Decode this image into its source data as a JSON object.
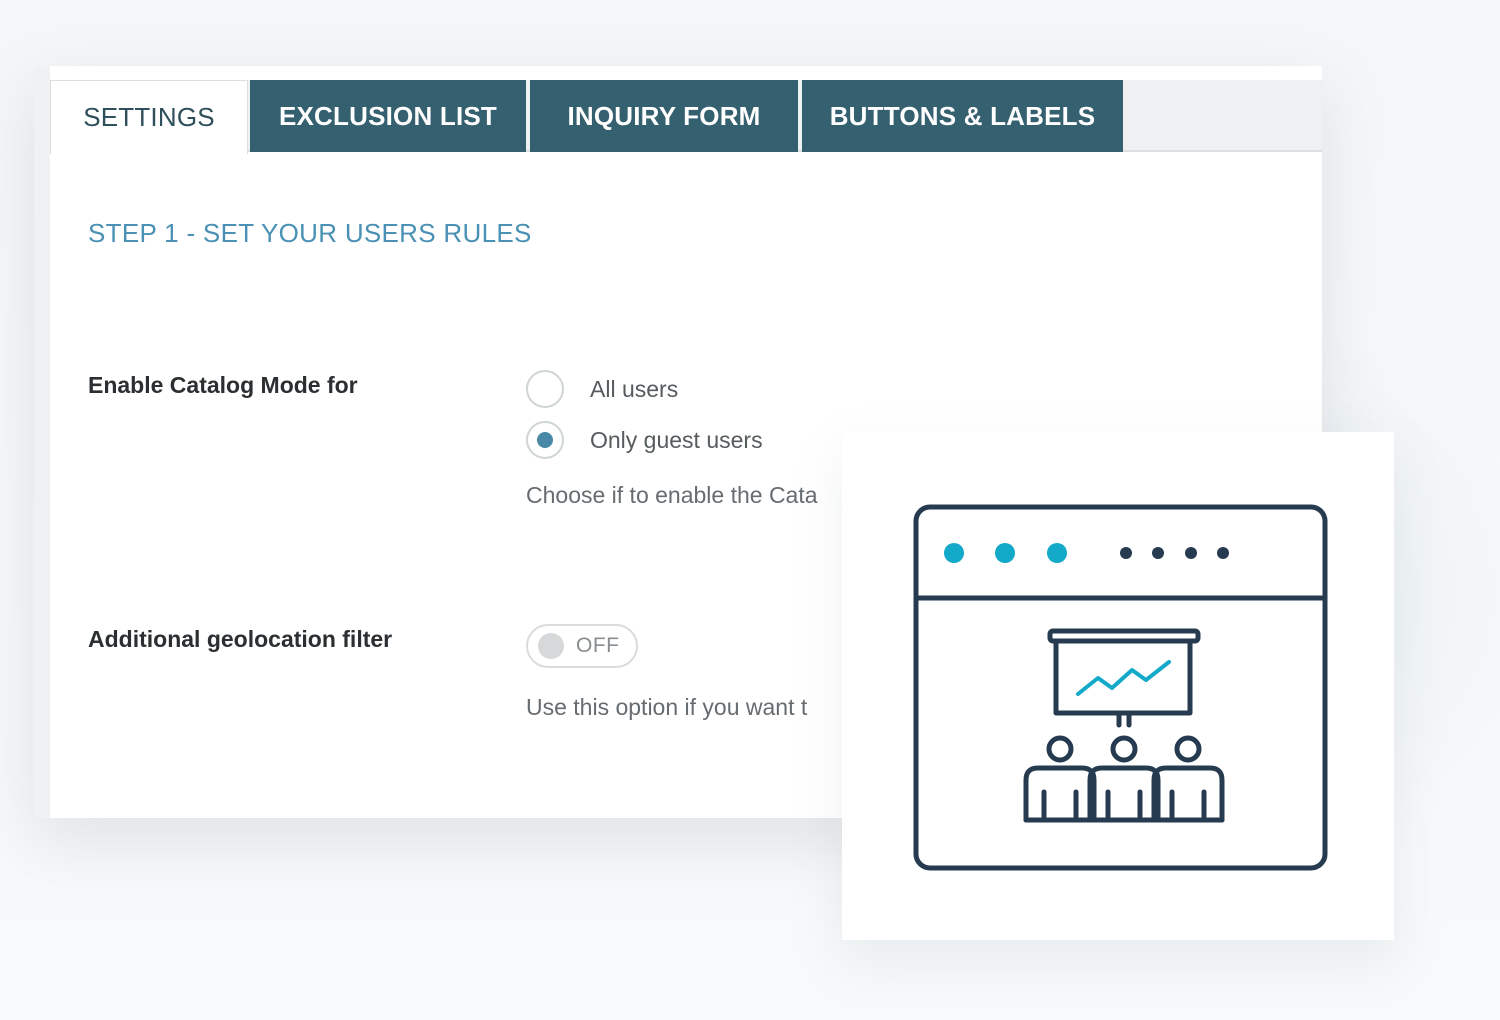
{
  "tabs": [
    {
      "label": "SETTINGS",
      "active": true
    },
    {
      "label": "EXCLUSION LIST",
      "active": false
    },
    {
      "label": "INQUIRY FORM",
      "active": false
    },
    {
      "label": "BUTTONS & LABELS",
      "active": false
    }
  ],
  "step_title": "STEP 1 - SET YOUR USERS RULES",
  "catalog_mode": {
    "label": "Enable Catalog Mode for",
    "options": [
      {
        "label": "All users",
        "checked": false
      },
      {
        "label": "Only guest users",
        "checked": true
      }
    ],
    "help": "Choose if to enable the Cata"
  },
  "geolocation": {
    "label": "Additional geolocation filter",
    "toggle_state": "OFF",
    "help": "Use this option if you want t"
  },
  "illustration": {
    "icon": "presentation-browser-icon",
    "accent_color": "#13a9c9",
    "line_color": "#263b4f"
  },
  "colors": {
    "tab_bg": "#35606f",
    "step_title": "#4a91b5",
    "radio_checked": "#4a88a8"
  }
}
